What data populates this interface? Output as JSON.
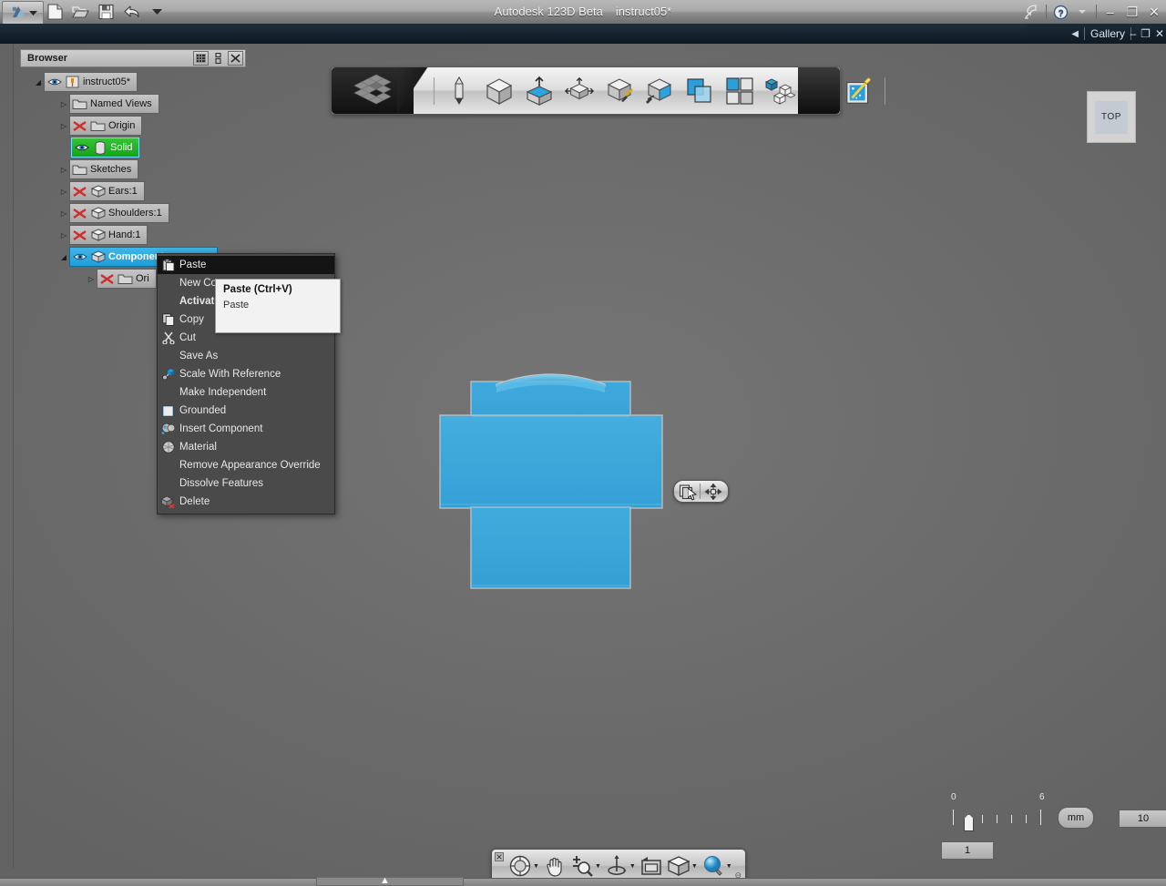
{
  "titlebar": {
    "app_title": "Autodesk 123D Beta",
    "document_name": "instruct05*",
    "app_menu_icon": "autodesk-logo-icon",
    "app_menu_caret": "chevron-down-icon",
    "quick_access": [
      {
        "name": "new-document-icon",
        "label": "New"
      },
      {
        "name": "open-document-icon",
        "label": "Open"
      },
      {
        "name": "save-document-icon",
        "label": "Save"
      },
      {
        "name": "undo-icon",
        "label": "Undo"
      },
      {
        "name": "customize-caret-icon",
        "label": "Customize"
      }
    ],
    "satellite_icon": "satellite-dish-icon",
    "help_icon": "help-question-icon",
    "help_caret": "chevron-down-icon",
    "minimize": "–",
    "restore": "❐",
    "close": "✕"
  },
  "gallerybar": {
    "collapse_arrow": "◀",
    "label": "Gallery",
    "panel_minimize": "–",
    "panel_restore": "❐",
    "panel_close": "✕"
  },
  "browser": {
    "title": "Browser",
    "header_buttons": [
      {
        "name": "filter-icon",
        "label": "Filter"
      },
      {
        "name": "panel-dock-icon",
        "label": "Dock"
      },
      {
        "name": "panel-close-icon",
        "label": "Close"
      }
    ],
    "tree": [
      {
        "label": "instruct05*",
        "indent": 0,
        "twisty": "expanded",
        "icons": [
          "visibility-eye-icon",
          "document-pin-icon"
        ],
        "state": "normal"
      },
      {
        "label": "Named Views",
        "indent": 1,
        "twisty": "collapsed",
        "icons": [
          "folder-icon"
        ],
        "state": "normal"
      },
      {
        "label": "Origin",
        "indent": 1,
        "twisty": "collapsed",
        "icons": [
          "hidden-x-icon",
          "folder-icon"
        ],
        "state": "normal"
      },
      {
        "label": "Solid",
        "indent": 1,
        "twisty": "none",
        "icons": [
          "visibility-eye-icon",
          "solid-body-icon"
        ],
        "state": "selected-green"
      },
      {
        "label": "Sketches",
        "indent": 1,
        "twisty": "collapsed",
        "icons": [
          "folder-icon"
        ],
        "state": "normal"
      },
      {
        "label": "Ears:1",
        "indent": 1,
        "twisty": "collapsed",
        "icons": [
          "hidden-x-icon",
          "component-cube-icon"
        ],
        "state": "normal"
      },
      {
        "label": "Shoulders:1",
        "indent": 1,
        "twisty": "collapsed",
        "icons": [
          "hidden-x-icon",
          "component-cube-icon"
        ],
        "state": "normal"
      },
      {
        "label": "Hand:1",
        "indent": 1,
        "twisty": "collapsed",
        "icons": [
          "hidden-x-icon",
          "component-cube-icon"
        ],
        "state": "normal"
      },
      {
        "label": "Component",
        "indent": 1,
        "twisty": "expanded",
        "icons": [
          "visibility-eye-icon",
          "component-cube-icon"
        ],
        "state": "selected"
      },
      {
        "label": "Ori",
        "indent": 2,
        "twisty": "collapsed",
        "icons": [
          "hidden-x-icon",
          "folder-icon"
        ],
        "state": "normal"
      }
    ]
  },
  "ribbon": {
    "logo_icon": "123d-cube-logo-icon",
    "tools": [
      {
        "name": "sketch-pencil-icon",
        "label": "Sketch"
      },
      {
        "name": "primitives-cube-icon",
        "label": "Primitives"
      },
      {
        "name": "extrude-icon",
        "label": "Construct"
      },
      {
        "name": "modify-arrows-icon",
        "label": "Modify"
      },
      {
        "name": "pattern-sketch-icon",
        "label": "Pattern"
      },
      {
        "name": "grouping-icon",
        "label": "Group"
      },
      {
        "name": "combine-shapes-icon",
        "label": "Combine"
      },
      {
        "name": "grid-panels-icon",
        "label": "Arrange"
      },
      {
        "name": "assembly-blocks-icon",
        "label": "Assemble"
      },
      {
        "name": "2d-drawing-star-icon",
        "label": "2D Drawing"
      },
      {
        "name": "smart-wand-icon",
        "label": "Smart Tools"
      }
    ]
  },
  "viewcube": {
    "label": "TOP"
  },
  "context_menu": {
    "items": [
      {
        "label": "Paste",
        "icon": "paste-clipboard-icon",
        "highlighted": true,
        "bold": false
      },
      {
        "label": "New Component",
        "icon": "none",
        "highlighted": false,
        "bold": false
      },
      {
        "label": "Activate",
        "icon": "none",
        "highlighted": false,
        "bold": true
      },
      {
        "label": "Copy",
        "icon": "copy-pages-icon",
        "highlighted": false,
        "bold": false
      },
      {
        "label": "Cut",
        "icon": "cut-scissors-icon",
        "highlighted": false,
        "bold": false
      },
      {
        "label": "Save As",
        "icon": "none",
        "highlighted": false,
        "bold": false
      },
      {
        "label": "Scale With Reference",
        "icon": "scale-reference-icon",
        "highlighted": false,
        "bold": false
      },
      {
        "label": "Make Independent",
        "icon": "none",
        "highlighted": false,
        "bold": false
      },
      {
        "label": "Grounded",
        "icon": "checkbox-empty-icon",
        "highlighted": false,
        "bold": false
      },
      {
        "label": "Insert Component",
        "icon": "insert-component-icon",
        "highlighted": false,
        "bold": false
      },
      {
        "label": "Material",
        "icon": "material-sphere-icon",
        "highlighted": false,
        "bold": false
      },
      {
        "label": "Remove Appearance Override",
        "icon": "none",
        "highlighted": false,
        "bold": false
      },
      {
        "label": "Dissolve Features",
        "icon": "none",
        "highlighted": false,
        "bold": false
      },
      {
        "label": "Delete",
        "icon": "delete-cube-icon",
        "highlighted": false,
        "bold": false
      }
    ]
  },
  "tooltip": {
    "title": "Paste (Ctrl+V)",
    "body": "Paste"
  },
  "mini_toolbar": {
    "buttons": [
      {
        "name": "copy-object-icon",
        "label": "Copy"
      },
      {
        "name": "move-gizmo-icon",
        "label": "Move"
      }
    ],
    "cursor": "arrow-cursor-icon"
  },
  "nav_toolbar": {
    "grip": "close-toolbar-icon",
    "buttons": [
      {
        "name": "steering-wheel-icon",
        "label": "SteeringWheels",
        "caret": true
      },
      {
        "name": "pan-hand-icon",
        "label": "Pan",
        "caret": false
      },
      {
        "name": "zoom-magnifier-icon",
        "label": "Zoom",
        "caret": true
      },
      {
        "name": "orbit-icon",
        "label": "Orbit",
        "caret": true
      },
      {
        "name": "look-at-icon",
        "label": "Look At",
        "caret": false
      },
      {
        "name": "view-cube-icon",
        "label": "View Cube",
        "caret": true
      },
      {
        "name": "magnify-sphere-icon",
        "label": "Zoom Window",
        "caret": true
      }
    ],
    "collapse": "⊖"
  },
  "scale_widget": {
    "tick_label_left": "0",
    "tick_label_right": "6",
    "current_value": "1",
    "unit": "mm",
    "grid_value": "10"
  },
  "colors": {
    "accent_blue": "#36a3d6",
    "model_fill": "#3aa4d8",
    "selection_blue": "#2aa6e0",
    "selection_green": "#22b322",
    "viewport_bg": "#6d6d6d",
    "titlebar_bg": "#a2a2a2",
    "gallery_bg": "#142431",
    "menu_bg": "#4a4a4a",
    "menu_highlight": "#141414"
  }
}
